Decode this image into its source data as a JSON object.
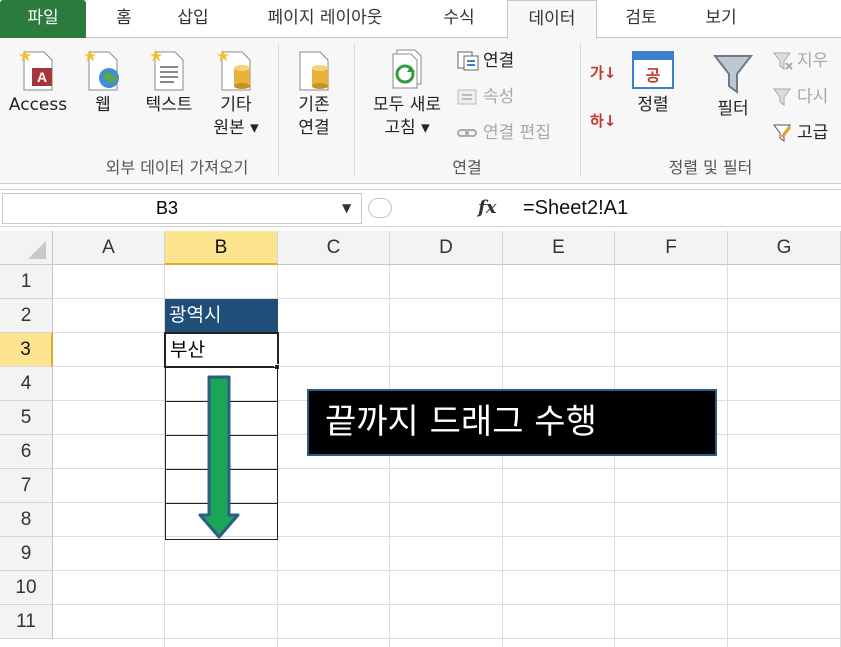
{
  "tabs": [
    "파일",
    "홈",
    "삽입",
    "페이지 레이아웃",
    "수식",
    "데이터",
    "검토",
    "보기"
  ],
  "ribbon": {
    "external": {
      "access": "Access",
      "web": "웹",
      "text": "텍스트",
      "other_l1": "기타",
      "other_l2": "원본 ▾",
      "group_label": "외부 데이터 가져오기"
    },
    "existing_l1": "기존",
    "existing_l2": "연결",
    "connections": {
      "refresh_l1": "모두 새로",
      "refresh_l2": "고침 ▾",
      "connect": "연결",
      "properties": "속성",
      "edit_links": "연결 편집",
      "group_label": "연결"
    },
    "sortfilter": {
      "sort_asc_icon": "가↓",
      "sort_desc_icon": "하↓",
      "sort": "정렬",
      "filter": "필터",
      "clear": "지우",
      "reapply": "다시",
      "advanced": "고급",
      "group_label": "정렬 및 필터"
    }
  },
  "formula_bar": {
    "name_box": "B3",
    "fx": "fx",
    "formula": "=Sheet2!A1"
  },
  "sheet": {
    "columns": [
      "A",
      "B",
      "C",
      "D",
      "E",
      "F",
      "G"
    ],
    "rows": [
      "1",
      "2",
      "3",
      "4",
      "5",
      "6",
      "7",
      "8",
      "9",
      "10",
      "11"
    ],
    "selected_column": "B",
    "selected_row": "3",
    "cells": {
      "B2": "광역시",
      "B3": "부산"
    }
  },
  "callout": "끝까지 드래그 수행",
  "colors": {
    "file_tab": "#2b7b3e",
    "header_fill": "#1f4e79",
    "selected_header": "#fde58f",
    "arrow_fill": "#1aa653",
    "arrow_stroke": "#2e5c8a"
  }
}
